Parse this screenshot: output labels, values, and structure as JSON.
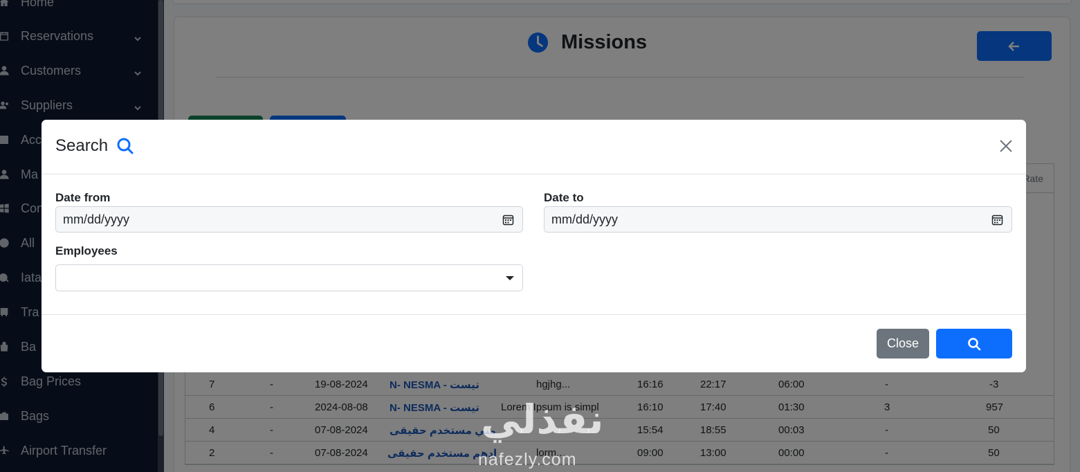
{
  "sidebar": {
    "items": [
      {
        "label": "Home",
        "icon": "home-icon",
        "chevron": false
      },
      {
        "label": "Reservations",
        "icon": "calendar-icon",
        "chevron": true
      },
      {
        "label": "Customers",
        "icon": "user-icon",
        "chevron": true
      },
      {
        "label": "Suppliers",
        "icon": "users-icon",
        "chevron": true
      },
      {
        "label": "Acc",
        "icon": "building-icon",
        "chevron": false
      },
      {
        "label": "Ma",
        "icon": "user-tie-icon",
        "chevron": false
      },
      {
        "label": "Con",
        "icon": "windows-icon",
        "chevron": false
      },
      {
        "label": "All ",
        "icon": "globe-icon",
        "chevron": false
      },
      {
        "label": "Iata",
        "icon": "globe-plane-icon",
        "chevron": false
      },
      {
        "label": "Tra",
        "icon": "bus-icon",
        "chevron": false
      },
      {
        "label": "Ba",
        "icon": "bag-icon",
        "chevron": false
      },
      {
        "label": "Bag Prices",
        "icon": "dollar-icon",
        "chevron": false
      },
      {
        "label": "Bags",
        "icon": "suitcase-icon",
        "chevron": false
      },
      {
        "label": "Airport Transfer",
        "icon": "plane-icon",
        "chevron": false
      }
    ]
  },
  "page": {
    "title": "Missions",
    "title_icon": "clock-icon",
    "back_icon": "arrow-left-icon",
    "table_header_last": "Rate"
  },
  "table": {
    "rows": [
      [
        "7",
        "-",
        "19-08-2024",
        "N- NESMA - تيست",
        "hgjhg...",
        "16:16",
        "22:17",
        "06:00",
        "-",
        "-3"
      ],
      [
        "6",
        "-",
        "2024-08-08",
        "N- NESMA - تيست",
        "Lorem Ipsum is simpl",
        "16:10",
        "17:40",
        "01:30",
        "3",
        "957"
      ],
      [
        "4",
        "-",
        "07-08-2024",
        "مني مستخدم حقيقى",
        "",
        "15:54",
        "18:55",
        "00:03",
        "-",
        "50"
      ],
      [
        "2",
        "-",
        "07-08-2024",
        "ادهم مستخدم حقيقى",
        "lorm...",
        "09:00",
        "13:00",
        "00:00",
        "-",
        "50"
      ]
    ]
  },
  "modal": {
    "title": "Search",
    "title_icon": "search-icon",
    "date_from_label": "Date from",
    "date_from_placeholder": "mm/dd/yyyy",
    "date_to_label": "Date to",
    "date_to_placeholder": "mm/dd/yyyy",
    "employees_label": "Employees",
    "employees_value": "",
    "close_label": "Close",
    "search_icon": "search-icon"
  },
  "watermark": {
    "arabic": "نفذلي",
    "latin": "nafezly.com"
  },
  "colors": {
    "primary": "#0d6efd",
    "secondary": "#6c757d",
    "success": "#198754",
    "sidebar_bg": "#0c1b30"
  }
}
